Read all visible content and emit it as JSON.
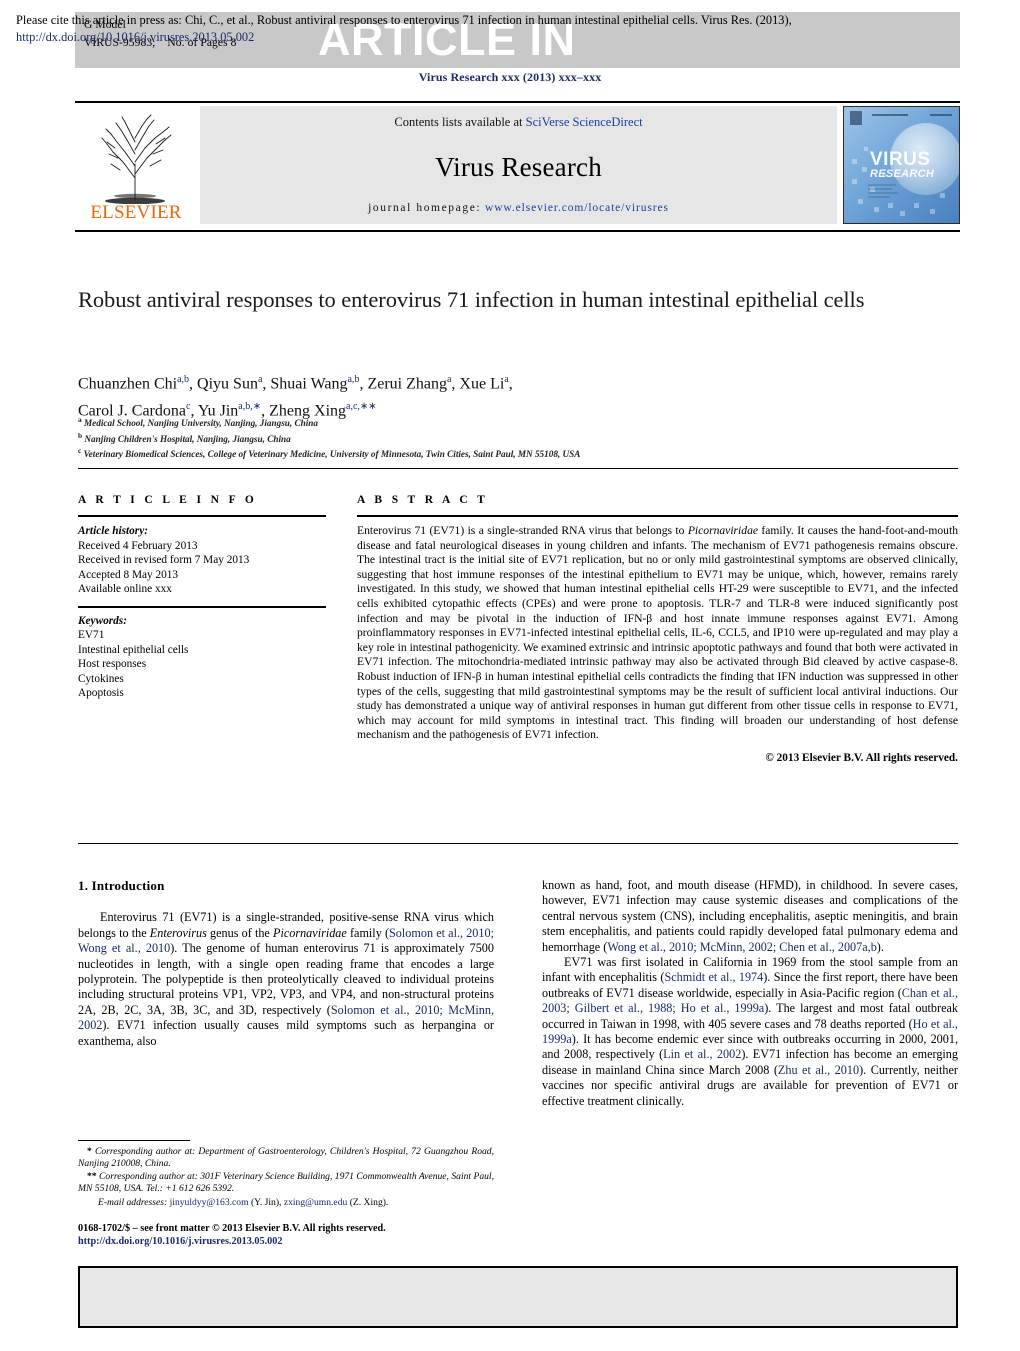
{
  "header": {
    "g_model": "G Model",
    "article_id": "VIRUS-95983;",
    "pages": "No. of Pages 8",
    "article_in_press": "ARTICLE IN PRESS",
    "journal_ref": "Virus Research xxx (2013) xxx–xxx"
  },
  "masthead": {
    "contents_prefix": "Contents lists available at ",
    "contents_link": "SciVerse ScienceDirect",
    "journal_title": "Virus Research",
    "homepage_label": "journal homepage:",
    "homepage_url": "www.elsevier.com/locate/virusres",
    "publisher": "ELSEVIER",
    "cover_title": "VIRUS",
    "cover_subtitle": "RESEARCH"
  },
  "article": {
    "title": "Robust antiviral responses to enterovirus 71 infection in human intestinal epithelial cells",
    "authors_line1": "Chuanzhen Chi<sup>a,b</sup>, Qiyu Sun<sup>a</sup>, Shuai Wang<sup>a,b</sup>, Zerui Zhang<sup>a</sup>, Xue Li<sup>a</sup>,",
    "authors_line2": "Carol J. Cardona<sup>c</sup>, Yu Jin<sup>a,b,</sup><sup>∗</sup>, Zheng Xing<sup>a,c,</sup><sup>∗∗</sup>",
    "affiliations": [
      "<sup>a</sup> Medical School, Nanjing University, Nanjing, Jiangsu, China",
      "<sup>b</sup> Nanjing Children's Hospital, Nanjing, Jiangsu, China",
      "<sup>c</sup> Veterinary Biomedical Sciences, College of Veterinary Medicine, University of Minnesota, Twin Cities, Saint Paul, MN 55108, USA"
    ]
  },
  "article_info": {
    "heading": "A R T I C L E  I N F O",
    "history_label": "Article history:",
    "history": [
      "Received 4 February 2013",
      "Received in revised form 7 May 2013",
      "Accepted 8 May 2013",
      "Available online xxx"
    ],
    "keywords_label": "Keywords:",
    "keywords": [
      "EV71",
      "Intestinal epithelial cells",
      "Host responses",
      "Cytokines",
      "Apoptosis"
    ]
  },
  "abstract": {
    "heading": "A B S T R A C T",
    "text": "Enterovirus 71 (EV71) is a single-stranded RNA virus that belongs to <i>Picornaviridae</i> family. It causes the hand-foot-and-mouth disease and fatal neurological diseases in young children and infants. The mechanism of EV71 pathogenesis remains obscure. The intestinal tract is the initial site of EV71 replication, but no or only mild gastrointestinal symptoms are observed clinically, suggesting that host immune responses of the intestinal epithelium to EV71 may be unique, which, however, remains rarely investigated. In this study, we showed that human intestinal epithelial cells HT-29 were susceptible to EV71, and the infected cells exhibited cytopathic effects (CPEs) and were prone to apoptosis. TLR-7 and TLR-8 were induced significantly post infection and may be pivotal in the induction of IFN-β and host innate immune responses against EV71. Among proinflammatory responses in EV71-infected intestinal epithelial cells, IL-6, CCL5, and IP10 were up-regulated and may play a key role in intestinal pathogenicity. We examined extrinsic and intrinsic apoptotic pathways and found that both were activated in EV71 infection. The mitochondria-mediated intrinsic pathway may also be activated through Bid cleaved by active caspase-8. Robust induction of IFN-β in human intestinal epithelial cells contradicts the finding that IFN induction was suppressed in other types of the cells, suggesting that mild gastrointestinal symptoms may be the result of sufficient local antiviral inductions. Our study has demonstrated a unique way of antiviral responses in human gut different from other tissue cells in response to EV71, which may account for mild symptoms in intestinal tract. This finding will broaden our understanding of host defense mechanism and the pathogenesis of EV71 infection.",
    "copyright": "© 2013 Elsevier B.V. All rights reserved."
  },
  "body": {
    "section_heading": "1. Introduction",
    "left_paragraph": "Enterovirus 71 (EV71) is a single-stranded, positive-sense RNA virus which belongs to the <i>Enterovirus</i> genus of the <i>Picornaviridae</i> family (<span class=\"ref\">Solomon et al., 2010; Wong et al., 2010</span>). The genome of human enterovirus 71 is approximately 7500 nucleotides in length, with a single open reading frame that encodes a large polyprotein. The polypeptide is then proteolytically cleaved to individual proteins including structural proteins VP1, VP2, VP3, and VP4, and non-structural proteins 2A, 2B, 2C, 3A, 3B, 3C, and 3D, respectively (<span class=\"ref\">Solomon et al., 2010; McMinn, 2002</span>). EV71 infection usually causes mild symptoms such as herpangina or exanthema, also",
    "right_paragraph_1": "known as hand, foot, and mouth disease (HFMD), in childhood. In severe cases, however, EV71 infection may cause systemic diseases and complications of the central nervous system (CNS), including encephalitis, aseptic meningitis, and brain stem encephalitis, and patients could rapidly developed fatal pulmonary edema and hemorrhage (<span class=\"ref\">Wong et al., 2010; McMinn, 2002; Chen et al., 2007a,b</span>).",
    "right_paragraph_2": "EV71 was first isolated in California in 1969 from the stool sample from an infant with encephalitis (<span class=\"ref\">Schmidt et al., 1974</span>). Since the first report, there have been outbreaks of EV71 disease worldwide, especially in Asia-Pacific region (<span class=\"ref\">Chan et al., 2003; Gilbert et al., 1988; Ho et al., 1999a</span>). The largest and most fatal outbreak occurred in Taiwan in 1998, with 405 severe cases and 78 deaths reported (<span class=\"ref\">Ho et al., 1999a</span>). It has become endemic ever since with outbreaks occurring in 2000, 2001, and 2008, respectively (<span class=\"ref\">Lin et al., 2002</span>). EV71 infection has become an emerging disease in mainland China since March 2008 (<span class=\"ref\">Zhu et al., 2010</span>). Currently, neither vaccines nor specific antiviral drugs are available for prevention of EV71 or effective treatment clinically."
  },
  "footnotes": {
    "note1": "<b>*</b> Corresponding author at: Department of Gastroenterology, Children's Hospital, 72 Guangzhou Road, Nanjing 210008, China.",
    "note2": "<b>**</b> Corresponding author at: 301F Veterinary Science Building, 1971 Commonwealth Avenue, Saint Paul, MN 55108, USA. Tel.: +1 612 626 5392.",
    "email_label": "E-mail addresses:",
    "email1": "jinyuldyy@163.com",
    "email1_owner": "(Y. Jin),",
    "email2": "zxing@umn.edu",
    "email2_owner": "(Z. Xing).",
    "frontmatter": "0168-1702/$ – see front matter © 2013 Elsevier B.V. All rights reserved.",
    "doi": "http://dx.doi.org/10.1016/j.virusres.2013.05.002"
  },
  "cite_box": {
    "text_part1": "Please cite this article in press as: Chi, C., et al., Robust antiviral responses to enterovirus 71 infection in human intestinal epithelial cells. Virus Res. (2013), ",
    "doi": "http://dx.doi.org/10.1016/j.virusres.2013.05.002"
  },
  "colors": {
    "link_blue": "#1a2a6c",
    "elsevier_orange": "#ec6608",
    "grey_bar": "#c8c8c8",
    "grey_panel": "#e6e6e6"
  }
}
